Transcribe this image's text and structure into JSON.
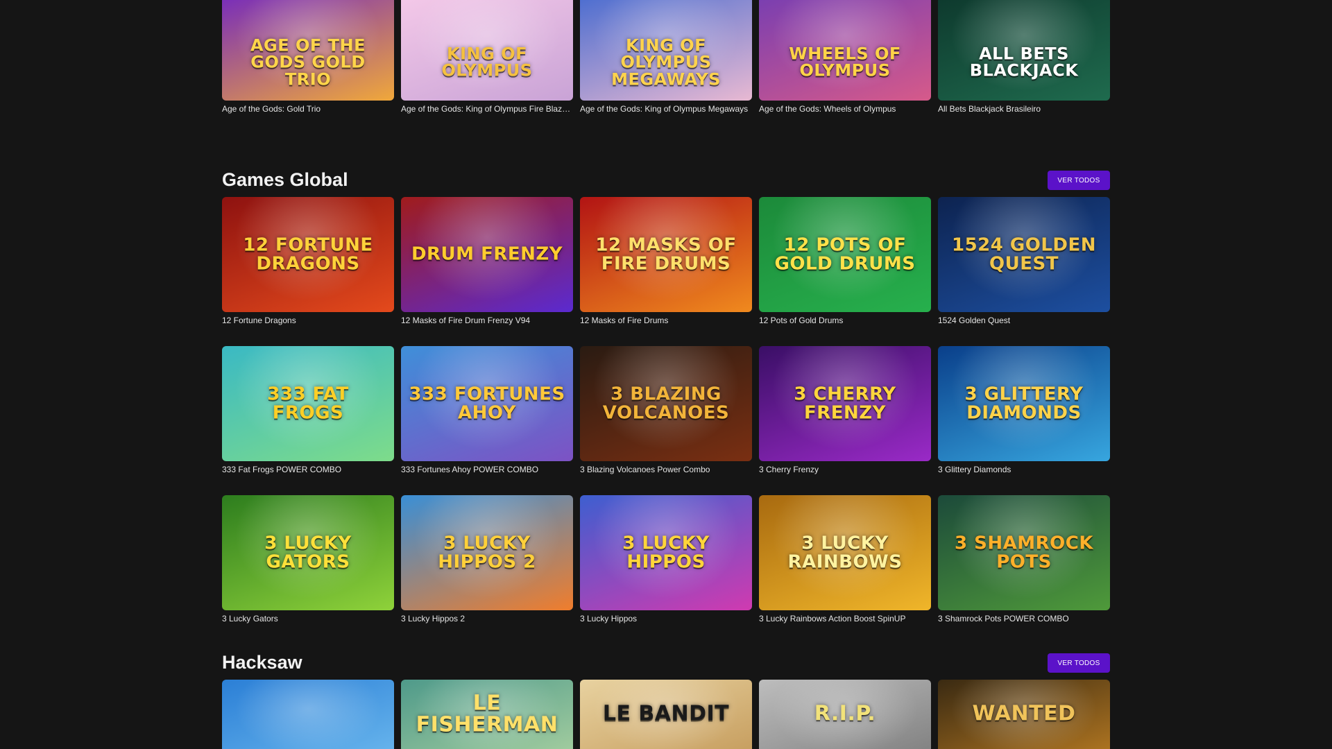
{
  "top_row": [
    {
      "title": "Age of the Gods: Gold Trio",
      "art_text": "AGE OF THE GODS GOLD TRIO",
      "colors": [
        "#7a2fb8",
        "#f0a83a"
      ],
      "text_color": "#ffd54a"
    },
    {
      "title": "Age of the Gods: King of Olympus Fire Blaze …",
      "art_text": "KING OF OLYMPUS",
      "colors": [
        "#f3c8e8",
        "#c9a3d6"
      ],
      "text_color": "#f5c140"
    },
    {
      "title": "Age of the Gods: King of Olympus Megaways",
      "art_text": "KING OF OLYMPUS MEGAWAYS",
      "colors": [
        "#4f6fd0",
        "#e8b9d2"
      ],
      "text_color": "#ffd34d"
    },
    {
      "title": "Age of the Gods: Wheels of Olympus",
      "art_text": "WHEELS OF OLYMPUS",
      "colors": [
        "#7b3fb0",
        "#d65a8a"
      ],
      "text_color": "#ffd447"
    },
    {
      "title": "All Bets Blackjack Brasileiro",
      "art_text": "ALL BETS BLACKJACK",
      "colors": [
        "#0e3a2e",
        "#1f6b4e"
      ],
      "text_color": "#ffffff"
    }
  ],
  "sections": {
    "games_global": {
      "title": "Games Global",
      "see_all_label": "VER TODOS",
      "games": [
        {
          "title": "12 Fortune Dragons",
          "art_text": "12 FORTUNE DRAGONS",
          "colors": [
            "#8e1210",
            "#e44a1c"
          ],
          "text_color": "#ffd23a"
        },
        {
          "title": "12 Masks of Fire Drum Frenzy V94",
          "art_text": "DRUM FRENZY",
          "colors": [
            "#a01c1c",
            "#5b2ad0"
          ],
          "text_color": "#ffcc2e"
        },
        {
          "title": "12 Masks of Fire Drums",
          "art_text": "12 MASKS OF FIRE DRUMS",
          "colors": [
            "#b21414",
            "#f08a1e"
          ],
          "text_color": "#ffe06b"
        },
        {
          "title": "12 Pots of Gold Drums",
          "art_text": "12 POTS OF GOLD DRUMS",
          "colors": [
            "#1c8a3a",
            "#27b04d"
          ],
          "text_color": "#ffe14a"
        },
        {
          "title": "1524 Golden Quest",
          "art_text": "1524 GOLDEN QUEST",
          "colors": [
            "#0d2350",
            "#1d4fa0"
          ],
          "text_color": "#f1c64a"
        },
        {
          "title": "333 Fat Frogs POWER COMBO",
          "art_text": "333 FAT FROGS",
          "colors": [
            "#3ab9c4",
            "#7edc8a"
          ],
          "text_color": "#ffcf26"
        },
        {
          "title": "333 Fortunes Ahoy POWER COMBO",
          "art_text": "333 FORTUNES AHOY",
          "colors": [
            "#3f8fd9",
            "#7d52c4"
          ],
          "text_color": "#ffc93a"
        },
        {
          "title": "3 Blazing Volcanoes Power Combo",
          "art_text": "3 BLAZING VOLCANOES",
          "colors": [
            "#2a1b12",
            "#7a2f12"
          ],
          "text_color": "#f2b43a"
        },
        {
          "title": "3 Cherry Frenzy",
          "art_text": "3 CHERRY FRENZY",
          "colors": [
            "#3a0f66",
            "#9a2ac7"
          ],
          "text_color": "#ffd53d"
        },
        {
          "title": "3 Glittery Diamonds",
          "art_text": "3 GLITTERY DIAMONDS",
          "colors": [
            "#0a3f8a",
            "#37a6df"
          ],
          "text_color": "#ffd34a"
        },
        {
          "title": "3 Lucky Gators",
          "art_text": "3 LUCKY GATORS",
          "colors": [
            "#2d7d1e",
            "#8fd23a"
          ],
          "text_color": "#ffe03a"
        },
        {
          "title": "3 Lucky Hippos 2",
          "art_text": "3 LUCKY HIPPOS 2",
          "colors": [
            "#3a8fd6",
            "#f07d2c"
          ],
          "text_color": "#ffd03a"
        },
        {
          "title": "3 Lucky Hippos",
          "art_text": "3 LUCKY HIPPOS",
          "colors": [
            "#3d5fd0",
            "#d03ab0"
          ],
          "text_color": "#ffd53a"
        },
        {
          "title": "3 Lucky Rainbows Action Boost SpinUP",
          "art_text": "3 LUCKY RAINBOWS",
          "colors": [
            "#a86a10",
            "#f0b62a"
          ],
          "text_color": "#fff3a0"
        },
        {
          "title": "3 Shamrock Pots POWER COMBO",
          "art_text": "3 SHAMROCK POTS",
          "colors": [
            "#1c4a3a",
            "#4f9a3a"
          ],
          "text_color": "#ffb02a"
        }
      ]
    },
    "hacksaw": {
      "title": "Hacksaw",
      "see_all_label": "VER TODOS",
      "games": [
        {
          "art_text": "",
          "colors": [
            "#2b7fd6",
            "#6bb8ee"
          ],
          "text_color": "#ffffff"
        },
        {
          "art_text": "LE FISHERMAN",
          "colors": [
            "#4f9a8a",
            "#a8d0a0"
          ],
          "text_color": "#ffe06a"
        },
        {
          "art_text": "LE BANDIT",
          "colors": [
            "#e8d2a0",
            "#c49a5a"
          ],
          "text_color": "#1a1a1a"
        },
        {
          "art_text": "R.I.P.",
          "colors": [
            "#bdbdbd",
            "#7d7d7d"
          ],
          "text_color": "#f2e27a"
        },
        {
          "art_text": "WANTED",
          "colors": [
            "#3a2a12",
            "#b77a22"
          ],
          "text_color": "#f0c35a"
        }
      ]
    }
  }
}
